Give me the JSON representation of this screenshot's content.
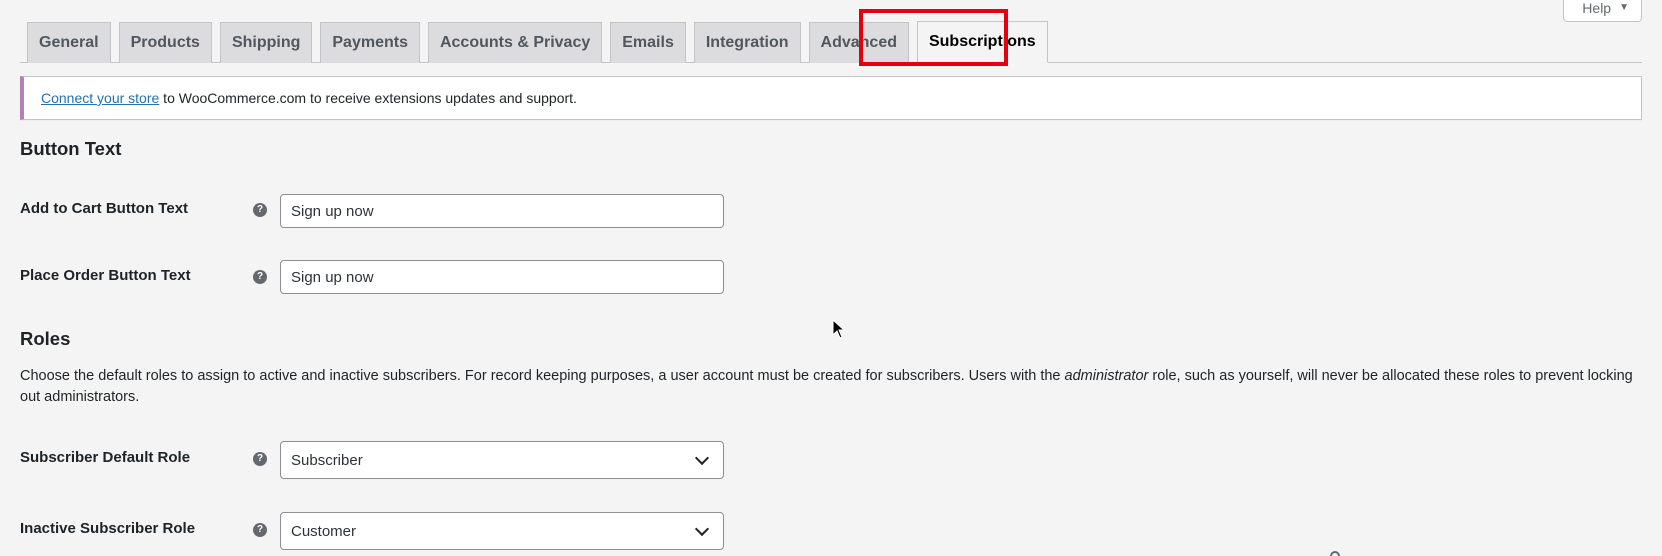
{
  "help": {
    "label": "Help",
    "caret": "▼"
  },
  "tabs": [
    {
      "label": "General"
    },
    {
      "label": "Products"
    },
    {
      "label": "Shipping"
    },
    {
      "label": "Payments"
    },
    {
      "label": "Accounts & Privacy"
    },
    {
      "label": "Emails"
    },
    {
      "label": "Integration"
    },
    {
      "label": "Advanced"
    },
    {
      "label": "Subscriptions",
      "active": true
    }
  ],
  "notice": {
    "link_text": "Connect your store",
    "rest_text": " to WooCommerce.com to receive extensions updates and support."
  },
  "button_text_section": {
    "title": "Button Text",
    "add_to_cart": {
      "label": "Add to Cart Button Text",
      "value": "Sign up now"
    },
    "place_order": {
      "label": "Place Order Button Text",
      "value": "Sign up now"
    }
  },
  "roles_section": {
    "title": "Roles",
    "desc_before": "Choose the default roles to assign to active and inactive subscribers. For record keeping purposes, a user account must be created for subscribers. Users with the ",
    "desc_em": "administrator",
    "desc_after": " role, such as yourself, will never be allocated these roles to prevent locking out administrators.",
    "default_role": {
      "label": "Subscriber Default Role",
      "value": "Subscriber"
    },
    "inactive_role": {
      "label": "Inactive Subscriber Role",
      "value": "Customer"
    }
  },
  "colors": {
    "highlight": "#e3000f",
    "notice_accent": "#b480b8",
    "link": "#2271b1"
  }
}
